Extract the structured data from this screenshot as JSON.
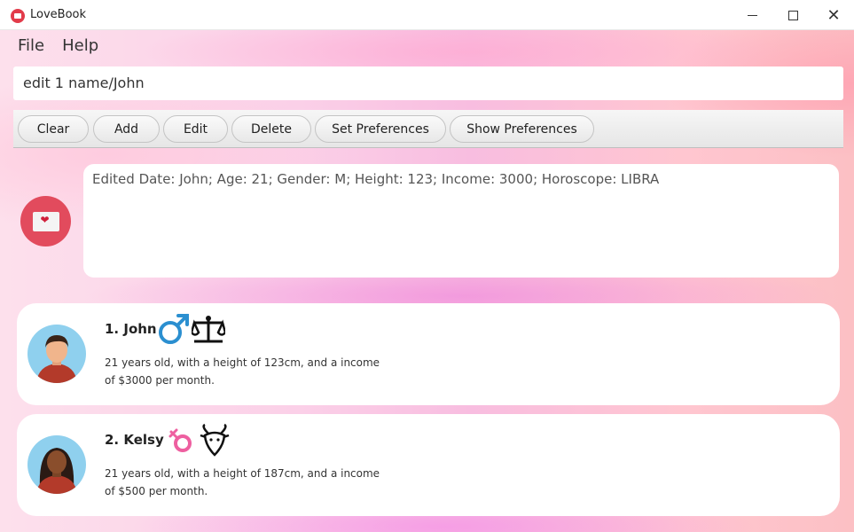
{
  "window": {
    "title": "LoveBook"
  },
  "menu": {
    "items": [
      "File",
      "Help"
    ]
  },
  "command": {
    "value": "edit 1 name/John"
  },
  "toolbar": {
    "buttons": [
      "Clear",
      "Add",
      "Edit",
      "Delete",
      "Set Preferences",
      "Show Preferences"
    ]
  },
  "result": {
    "text": "Edited Date: John; Age: 21; Gender: M; Height: 123; Income: 3000; Horoscope: LIBRA"
  },
  "dates": [
    {
      "name": "1.  John",
      "gender_icon": "male-icon",
      "horoscope_icon": "libra-icon",
      "description": "21 years old, with a height of 123cm, and a income of $3000 per month."
    },
    {
      "name": "2.  Kelsy",
      "gender_icon": "female-icon",
      "horoscope_icon": "capricorn-goat-icon",
      "description": "21 years old, with a height of 187cm, and a income of $500 per month."
    }
  ],
  "colors": {
    "accent": "#e24b5d",
    "male": "#2b8fd0",
    "female": "#ee5fa0"
  }
}
